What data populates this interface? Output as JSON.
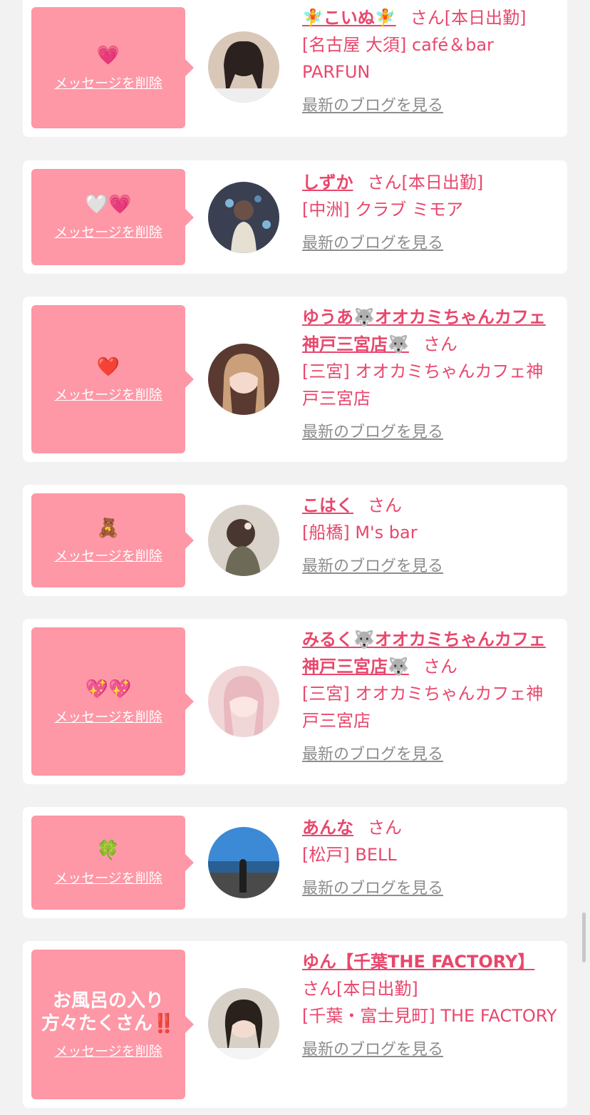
{
  "delete_label": "メッセージを削除",
  "blog_label": "最新のブログを見る",
  "suffix_san": "さん",
  "today_badge": "[本日出勤]",
  "colors": {
    "bubble": "#fe97a6",
    "accent": "#e8476c",
    "link_gray": "#8d8d8d",
    "background": "#f2f2f2"
  },
  "entries": [
    {
      "message": "💗",
      "name": "🧚こいぬ🧚",
      "shop": "[名古屋 大須] café＆bar PARFUN",
      "today": true
    },
    {
      "message": "🤍💗",
      "name": "しずか",
      "shop": "[中洲] クラブ ミモア",
      "today": true
    },
    {
      "message": "❤️",
      "name": "ゆうあ🐺オオカミちゃんカフェ神戸三宮店🐺",
      "shop": "[三宮] オオカミちゃんカフェ神戸三宮店",
      "today": false
    },
    {
      "message": "🧸",
      "name": "こはく",
      "shop": "[船橋] M's bar",
      "today": false
    },
    {
      "message": "💖💖",
      "name": "みるく🐺オオカミちゃんカフェ神戸三宮店🐺",
      "shop": "[三宮] オオカミちゃんカフェ神戸三宮店",
      "today": false
    },
    {
      "message": "🍀",
      "name": "あんな",
      "shop": "[松戸] BELL",
      "today": false
    },
    {
      "message": "お風呂の入り方々たくさん‼️",
      "name": "ゆん【千葉THE FACTORY】",
      "shop": "[千葉・富士見町] THE FACTORY",
      "today": true
    }
  ]
}
